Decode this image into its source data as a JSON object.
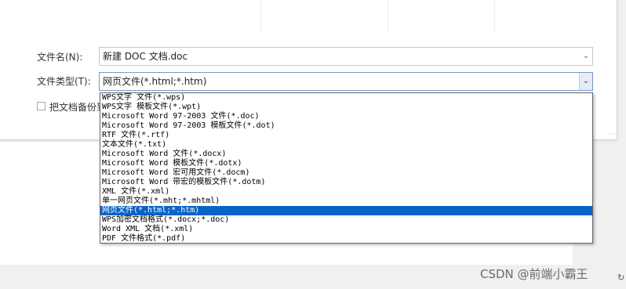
{
  "dialog": {
    "filename_label": "文件名(N):",
    "filename_value": "新建 DOC 文档.doc",
    "filetype_label": "文件类型(T):",
    "filetype_value": "网页文件(*.html;*.htm)",
    "backup_label": "把文档备份到"
  },
  "filetype_options": [
    {
      "label": "WPS文字 文件(*.wps)",
      "selected": false
    },
    {
      "label": "WPS文字 模板文件(*.wpt)",
      "selected": false
    },
    {
      "label": "Microsoft Word 97-2003 文件(*.doc)",
      "selected": false
    },
    {
      "label": "Microsoft Word 97-2003 模板文件(*.dot)",
      "selected": false
    },
    {
      "label": "RTF 文件(*.rtf)",
      "selected": false
    },
    {
      "label": "文本文件(*.txt)",
      "selected": false
    },
    {
      "label": "Microsoft Word 文件(*.docx)",
      "selected": false
    },
    {
      "label": "Microsoft Word 模板文件(*.dotx)",
      "selected": false
    },
    {
      "label": "Microsoft Word 宏可用文件(*.docm)",
      "selected": false
    },
    {
      "label": "Microsoft Word 带宏的模板文件(*.dotm)",
      "selected": false
    },
    {
      "label": "XML 文件(*.xml)",
      "selected": false
    },
    {
      "label": "单一网页文件(*.mht;*.mhtml)",
      "selected": false
    },
    {
      "label": "网页文件(*.html;*.htm)",
      "selected": true
    },
    {
      "label": "WPS加密文档格式(*.docx;*.doc)",
      "selected": false
    },
    {
      "label": "Word XML 文档(*.xml)",
      "selected": false
    },
    {
      "label": "PDF 文件格式(*.pdf)",
      "selected": false
    }
  ],
  "watermark": "CSDN @前端小霸王",
  "icons": {
    "dropdown": "chevron-down-icon",
    "resize": "resize-grip-icon",
    "corner": "partial-icon"
  },
  "colors": {
    "selection": "#0a64c8",
    "listbox_border": "#646464",
    "active_combo_border": "#7a98c6"
  }
}
